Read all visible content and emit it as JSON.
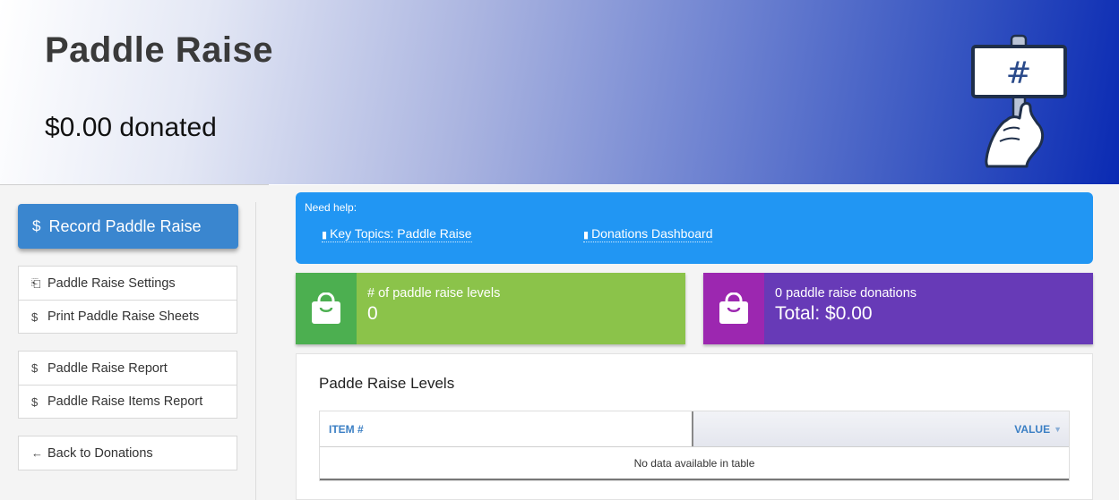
{
  "header": {
    "title": "Paddle Raise",
    "donated": "$0.00 donated",
    "icon": "paddle-sign-icon",
    "sign_text": "#"
  },
  "sidebar": {
    "primary_button": {
      "label": "Record Paddle Raise",
      "icon": "$"
    },
    "groups": [
      [
        {
          "icon": "⎗",
          "label": "Paddle Raise Settings"
        },
        {
          "icon": "$",
          "label": "Print Paddle Raise Sheets"
        }
      ],
      [
        {
          "icon": "$",
          "label": "Paddle Raise Report"
        },
        {
          "icon": "$",
          "label": "Paddle Raise Items Report"
        }
      ],
      [
        {
          "icon": "←",
          "label": "Back to Donations"
        }
      ]
    ]
  },
  "help": {
    "title": "Need help:",
    "links": [
      {
        "icon": "book-icon",
        "label": "Key Topics: Paddle Raise"
      },
      {
        "icon": "book-icon",
        "label": "Donations Dashboard"
      }
    ]
  },
  "stats": [
    {
      "label": "# of paddle raise levels",
      "value": "0",
      "color": "#8bc34a",
      "icon_bg": "#4caf50",
      "icon": "shopping-bag-icon"
    },
    {
      "label": "0 paddle raise donations",
      "value": "Total: $0.00",
      "color": "#673ab7",
      "icon_bg": "#9c27b0",
      "icon": "shopping-bag-icon"
    }
  ],
  "levels_panel": {
    "title": "Padde Raise Levels",
    "columns": [
      "ITEM #",
      "VALUE"
    ],
    "empty_text": "No data available in table"
  },
  "colors": {
    "help_bg": "#2196f3",
    "primary_button": "#3a86cf",
    "header_gradient_end": "#0a2ab3"
  }
}
